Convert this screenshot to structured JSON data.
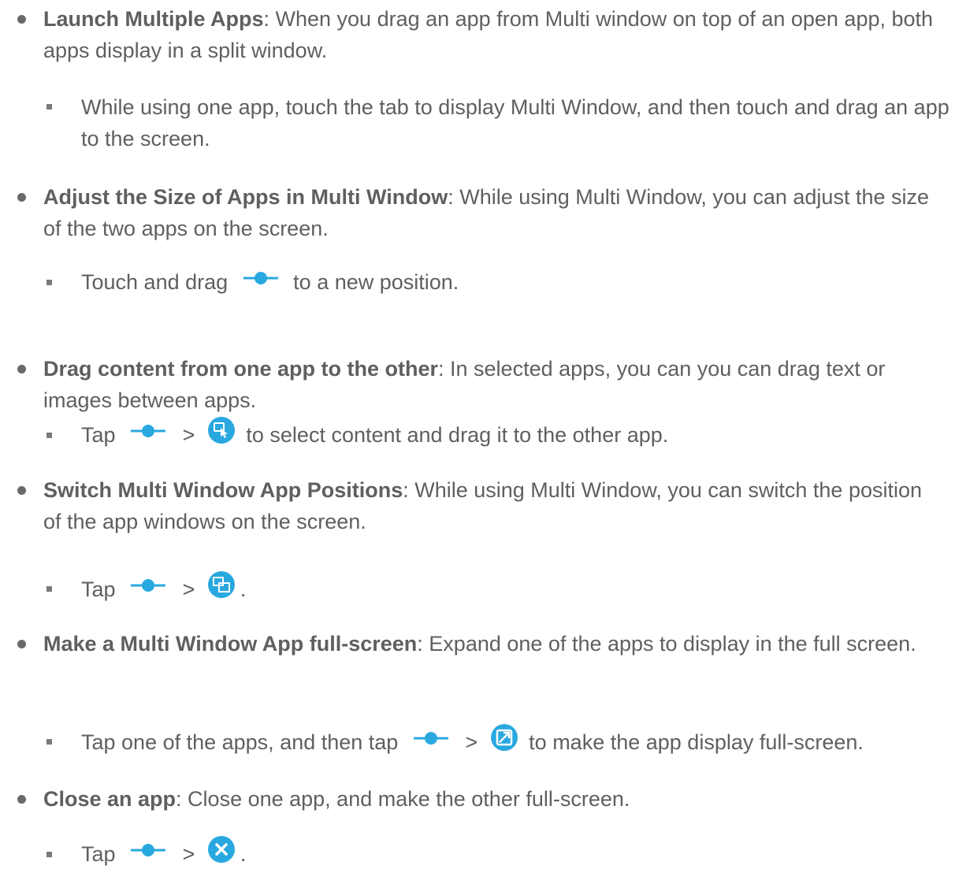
{
  "colors": {
    "text": "#5f5f5f",
    "accent": "#29a8e0"
  },
  "items": [
    {
      "title": "Launch Multiple Apps",
      "desc": ": When you drag an app from Multi window on top of an open app, both apps display in a split window.",
      "sub": {
        "text": "While using one app, touch the tab to display Multi Window, and then touch and drag an app to the screen."
      }
    },
    {
      "title": "Adjust the Size of Apps in Multi Window",
      "desc": ": While using Multi Window, you can adjust the size of the two apps on the screen.",
      "sub": {
        "pre": "Touch and drag",
        "icon": "multi-window-handle-icon",
        "post": "to a new position."
      }
    },
    {
      "title": "Drag content from one app to the other",
      "desc": ": In selected apps, you can you can drag text or images between apps.",
      "sub": {
        "pre": "Tap",
        "sep": ">",
        "icon": "drag-content-icon",
        "post": "to select content and drag it to the other app."
      }
    },
    {
      "title": "Switch Multi Window App Positions",
      "desc": ": While using Multi Window, you can switch the position of the app windows on the screen.",
      "sub": {
        "pre": "Tap",
        "sep": ">",
        "icon": "switch-windows-icon",
        "post": "."
      }
    },
    {
      "title": "Make a Multi Window App full-screen",
      "desc": ": Expand one of the apps to display in the full screen.",
      "sub": {
        "pre": "Tap one of the apps, and then tap",
        "sep": ">",
        "icon": "full-screen-icon",
        "post": "to make the app display full-screen."
      }
    },
    {
      "title": "Close an app",
      "desc": ": Close one app, and make the other full-screen.",
      "sub": {
        "pre": "Tap",
        "sep": ">",
        "icon": "close-app-icon",
        "post": "."
      }
    }
  ]
}
